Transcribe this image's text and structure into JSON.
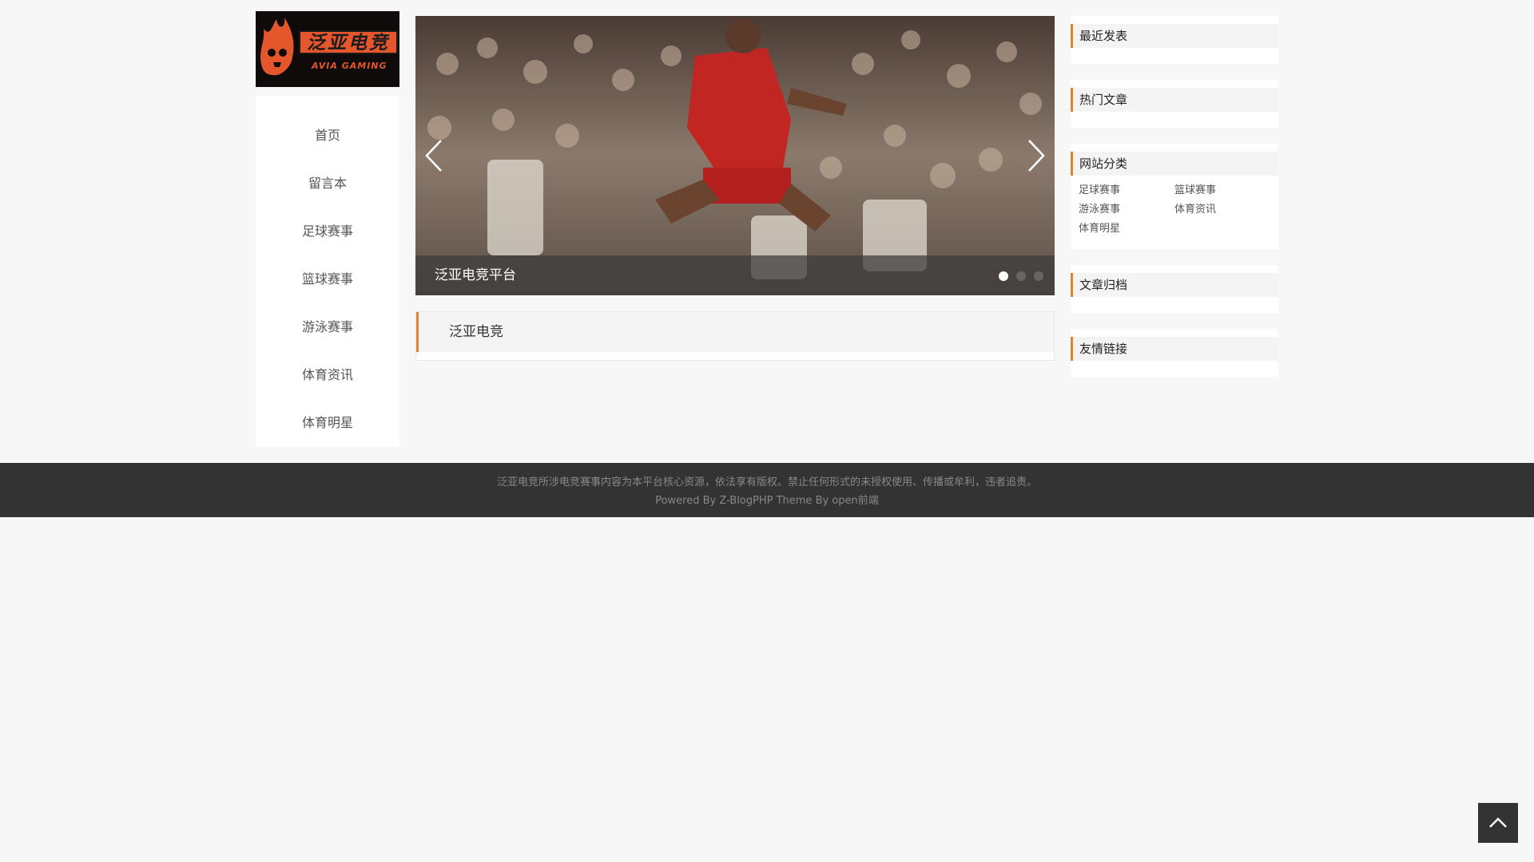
{
  "site": {
    "logo_text": "泛亚电竞",
    "logo_subtext": "AVIA GAMING",
    "brand_color": "#e4562b"
  },
  "nav": {
    "items": [
      {
        "label": "首页"
      },
      {
        "label": "留言本"
      },
      {
        "label": "足球赛事"
      },
      {
        "label": "篮球赛事"
      },
      {
        "label": "游泳赛事"
      },
      {
        "label": "体育资讯"
      },
      {
        "label": "体育明星"
      }
    ]
  },
  "slider": {
    "caption": "泛亚电竞平台",
    "slide_count": 3,
    "active_index": 1,
    "prev_icon": "chevron-left-icon",
    "next_icon": "chevron-right-icon"
  },
  "post": {
    "title": "泛亚电竞"
  },
  "sidebar": {
    "accent_color": "#e4842a",
    "widgets": [
      {
        "title": "最近发表"
      },
      {
        "title": "热门文章"
      },
      {
        "title": "网站分类",
        "categories": [
          "足球赛事",
          "篮球赛事",
          "游泳赛事",
          "体育资讯",
          "体育明星"
        ]
      },
      {
        "title": "文章归档"
      },
      {
        "title": "友情链接"
      }
    ]
  },
  "footer": {
    "line1": "泛亚电竞所涉电竞赛事内容为本平台核心资源，依法享有版权。禁止任何形式的未授权使用、传播或牟利，违者追责。",
    "line2": "Powered By Z-BlogPHP Theme By open前端"
  },
  "back_to_top": {
    "icon": "chevron-up-icon"
  }
}
